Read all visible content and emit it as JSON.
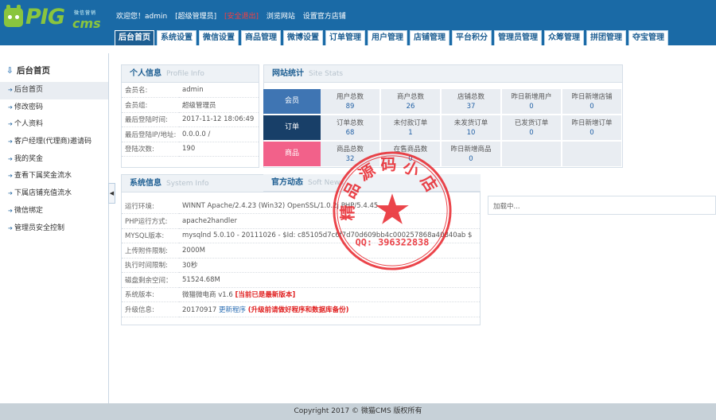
{
  "logo": {
    "pig": "PIG",
    "cms": "cms",
    "tag": "微信营销"
  },
  "topbar": {
    "welcome": "欢迎您！admin",
    "role": "[超级管理员]",
    "logout": "[安全退出]",
    "browse": "浏览网站",
    "official": "设置官方店铺"
  },
  "nav": [
    "后台首页",
    "系统设置",
    "微信设置",
    "商品管理",
    "微博设置",
    "订单管理",
    "用户管理",
    "店铺管理",
    "平台积分",
    "管理员管理",
    "众筹管理",
    "拼团管理",
    "夺宝管理"
  ],
  "sidebar": {
    "title": "后台首页",
    "items": [
      "后台首页",
      "修改密码",
      "个人资料",
      "客户经理(代理商)邀请码",
      "我的奖金",
      "查看下属奖金流水",
      "下属店铺充值流水",
      "微信绑定",
      "管理员安全控制"
    ]
  },
  "profile": {
    "title": "个人信息",
    "title_en": "Profile   Info",
    "rows": [
      {
        "k": "会员名:",
        "v": "admin"
      },
      {
        "k": "会员组:",
        "v": "超级管理员"
      },
      {
        "k": "最后登陆时间:",
        "v": "2017-11-12 18:06:49"
      },
      {
        "k": "最后登陆IP/地址:",
        "v": "0.0.0.0 /"
      },
      {
        "k": "登陆次数:",
        "v": "190"
      }
    ]
  },
  "stats": {
    "title": "网站统计",
    "title_en": "Site   Stats",
    "member_label": "会员",
    "order_label": "订单",
    "goods_label": "商品",
    "member_cells": [
      {
        "t": "用户总数",
        "v": "89"
      },
      {
        "t": "商户总数",
        "v": "26"
      },
      {
        "t": "店铺总数",
        "v": "37"
      },
      {
        "t": "昨日新增用户",
        "v": "0"
      },
      {
        "t": "昨日新增店铺",
        "v": "0"
      }
    ],
    "order_cells": [
      {
        "t": "订单总数",
        "v": "68"
      },
      {
        "t": "未付款订单",
        "v": "1"
      },
      {
        "t": "未发货订单",
        "v": "10"
      },
      {
        "t": "已发货订单",
        "v": "0"
      },
      {
        "t": "昨日新增订单",
        "v": "0"
      }
    ],
    "goods_cells": [
      {
        "t": "商品总数",
        "v": "32"
      },
      {
        "t": "在售商品数",
        "v": "0"
      },
      {
        "t": "昨日新增商品",
        "v": "0"
      }
    ]
  },
  "system": {
    "title": "系统信息",
    "title_en": "System   Info",
    "rows": [
      {
        "k": "运行环境:",
        "v": "WINNT Apache/2.4.23 (Win32) OpenSSL/1.0.2j PHP/5.4.45"
      },
      {
        "k": "PHP运行方式:",
        "v": "apache2handler"
      },
      {
        "k": "MYSQL版本:",
        "v": "mysqlnd 5.0.10 - 20111026 - $Id: c85105d7c6f7d70d609bb4c000257868a40840ab $"
      },
      {
        "k": "上传附件限制:",
        "v": "2000M"
      },
      {
        "k": "执行时间限制:",
        "v": "30秒"
      },
      {
        "k": "磁盘剩余空间：",
        "v": "51524.68M"
      }
    ],
    "version_label": "系统版本:",
    "version_value": "微猫微电商 v1.6",
    "version_note": "[当前已是最新版本]",
    "upgrade_label": "升级信息:",
    "upgrade_date": "20170917",
    "upgrade_link": "更新程序",
    "upgrade_note": "(升级前请做好程序和数据库备份)"
  },
  "news": {
    "title": "官方动态",
    "title_en": "Soft   News",
    "loading": "加载中..."
  },
  "stamp": {
    "top": "精品源码小店",
    "qq": "QQ: 396322838"
  },
  "footer": "Copyright 2017 © 微猫CMS 版权所有",
  "colors": {
    "header": "#1a6aa6",
    "member": "#3f75b3",
    "order": "#183f68",
    "goods": "#f2618a",
    "stamp": "#e8232a"
  }
}
